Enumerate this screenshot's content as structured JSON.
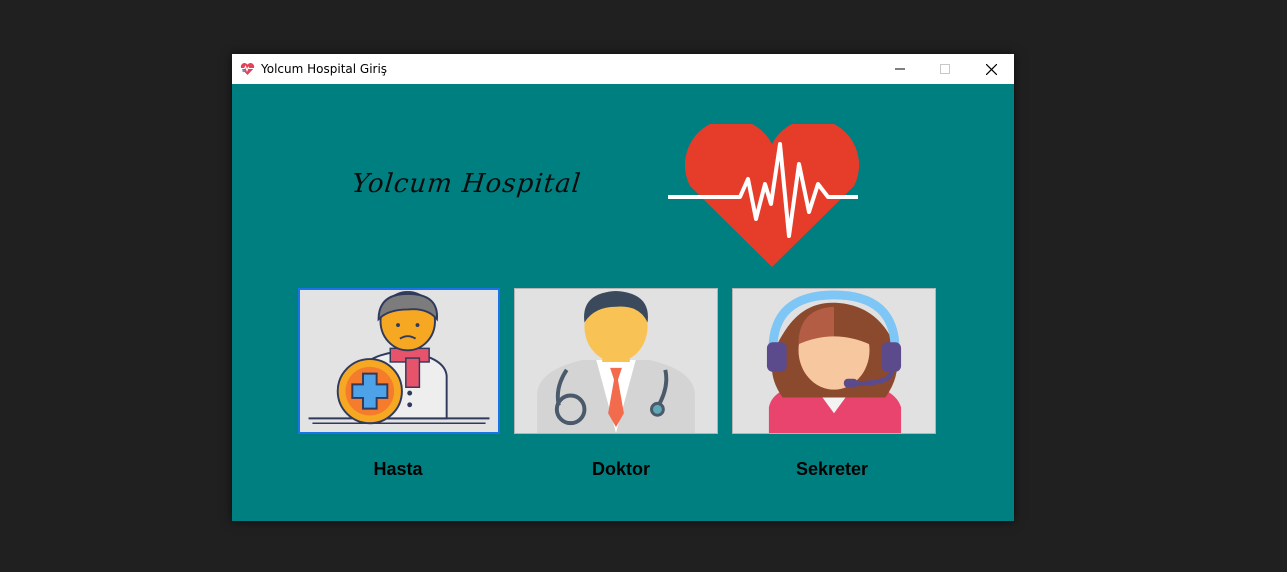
{
  "window": {
    "title": "Yolcum Hospital Giriş",
    "background_color": "#007f80"
  },
  "titlebar": {
    "app_icon": "heart-pulse-icon",
    "minimize_icon": "minimize-icon",
    "maximize_icon": "maximize-icon",
    "close_icon": "close-icon"
  },
  "brand": {
    "name": "Yolcum Hospital",
    "logo_icon": "heart-pulse-icon",
    "logo_color": "#e63c2a"
  },
  "roles": [
    {
      "label": "Hasta",
      "icon": "patient-icon",
      "focused": true
    },
    {
      "label": "Doktor",
      "icon": "doctor-icon",
      "focused": false
    },
    {
      "label": "Sekreter",
      "icon": "secretary-headset-icon",
      "focused": false
    }
  ],
  "colors": {
    "focus_border": "#1a73e8",
    "card_background": "#e1e1e1"
  }
}
